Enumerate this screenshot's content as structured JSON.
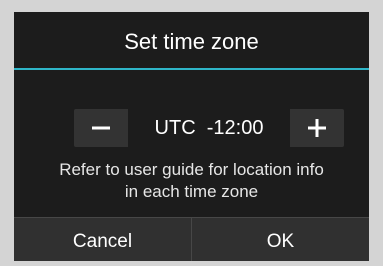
{
  "dialog": {
    "title": "Set time zone",
    "accent_color": "#2fb6c8",
    "stepper": {
      "value": "UTC  -12:00",
      "decrement_icon": "minus-icon",
      "increment_icon": "plus-icon"
    },
    "guide_line1": "Refer to user guide for location info",
    "guide_line2": "in each time zone",
    "buttons": {
      "cancel_label": "Cancel",
      "ok_label": "OK"
    }
  }
}
